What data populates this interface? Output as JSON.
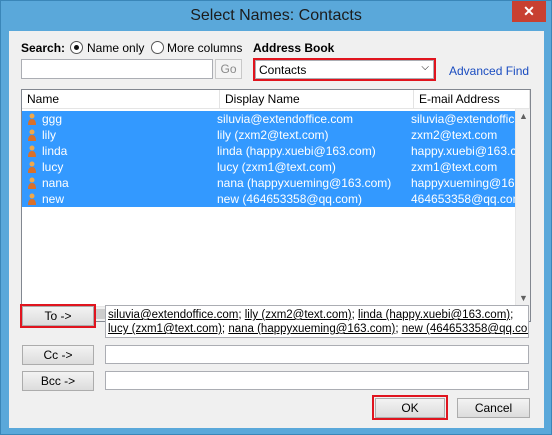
{
  "window": {
    "title": "Select Names: Contacts",
    "close_glyph": "✕"
  },
  "search": {
    "label": "Search:",
    "option_name_only": "Name only",
    "option_more_columns": "More columns",
    "selected": "name_only",
    "input_value": "",
    "go_label": "Go"
  },
  "address_book": {
    "label": "Address Book",
    "selected": "Contacts",
    "advanced_find": "Advanced Find"
  },
  "list": {
    "columns": [
      "Name",
      "Display Name",
      "E-mail Address"
    ],
    "rows": [
      {
        "name": "ggg",
        "display": "siluvia@extendoffice.com",
        "email": "siluvia@extendoffice.com"
      },
      {
        "name": "lily",
        "display": "lily (zxm2@text.com)",
        "email": "zxm2@text.com"
      },
      {
        "name": "linda",
        "display": "linda (happy.xuebi@163.com)",
        "email": "happy.xuebi@163.com"
      },
      {
        "name": "lucy",
        "display": "lucy (zxm1@text.com)",
        "email": "zxm1@text.com"
      },
      {
        "name": "nana",
        "display": "nana (happyxueming@163.com)",
        "email": "happyxueming@163.com"
      },
      {
        "name": "new",
        "display": "new (464653358@qq.com)",
        "email": "464653358@qq.com"
      }
    ],
    "selection_color": "#3399ff"
  },
  "recipients": {
    "to_label": "To ->",
    "cc_label": "Cc ->",
    "bcc_label": "Bcc ->",
    "to_line1": [
      "siluvia@extendoffice.com",
      "lily (zxm2@text.com)",
      "linda (happy.xuebi@163.com)"
    ],
    "to_line2": [
      "lucy (zxm1@text.com)",
      "nana (happyxueming@163.com)",
      "new (464653358@qq.com)"
    ],
    "separator": "; ",
    "cc_value": "",
    "bcc_value": ""
  },
  "footer": {
    "ok_label": "OK",
    "cancel_label": "Cancel"
  },
  "colors": {
    "highlight_box": "#e0141e",
    "title_bar": "#5aa8da",
    "close_button": "#c84031",
    "link": "#1a4cc0"
  }
}
